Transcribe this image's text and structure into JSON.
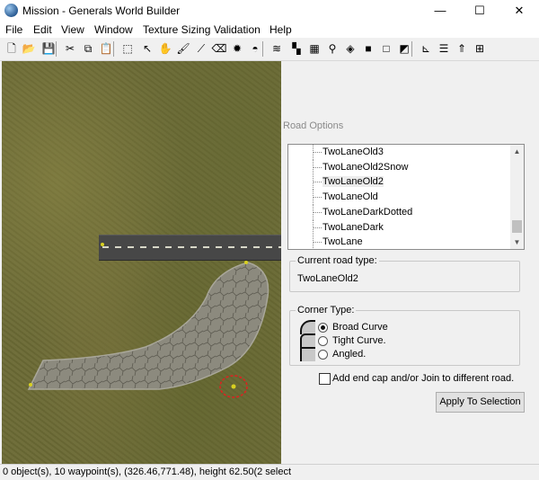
{
  "window": {
    "title": "Mission - Generals World Builder",
    "controls": [
      "—",
      "☐",
      "✕"
    ]
  },
  "menu": [
    "File",
    "Edit",
    "View",
    "Window",
    "Texture Sizing",
    "Validation",
    "Help"
  ],
  "toolbar_icons": [
    {
      "name": "new-file-icon",
      "glyph": "🗋"
    },
    {
      "name": "open-folder-icon",
      "glyph": "📂"
    },
    {
      "name": "save-icon",
      "glyph": "💾"
    },
    {
      "name": "cut-icon",
      "glyph": "✂"
    },
    {
      "name": "copy-icon",
      "glyph": "⧉"
    },
    {
      "name": "paste-icon",
      "glyph": "📋"
    },
    {
      "name": "select-icon",
      "glyph": "⬚"
    },
    {
      "name": "pointer-icon",
      "glyph": "↖"
    },
    {
      "name": "hand-icon",
      "glyph": "✋"
    },
    {
      "name": "brush-icon",
      "glyph": "🖌"
    },
    {
      "name": "feather-brush-icon",
      "glyph": "⟋"
    },
    {
      "name": "eraser-icon",
      "glyph": "⌫"
    },
    {
      "name": "sunburst-icon",
      "glyph": "✹"
    },
    {
      "name": "mound-icon",
      "glyph": "◓"
    },
    {
      "name": "water-icon",
      "glyph": "≋"
    },
    {
      "name": "tile-icon",
      "glyph": "▚"
    },
    {
      "name": "checker-icon",
      "glyph": "▦"
    },
    {
      "name": "eyedropper-icon",
      "glyph": "⚲"
    },
    {
      "name": "fill-icon",
      "glyph": "◈"
    },
    {
      "name": "square-icon",
      "glyph": "■"
    },
    {
      "name": "outline-square-icon",
      "glyph": "□"
    },
    {
      "name": "gradient-icon",
      "glyph": "◩"
    },
    {
      "name": "axis-icon",
      "glyph": "⊾"
    },
    {
      "name": "road-icon",
      "glyph": "☰"
    },
    {
      "name": "tree-icon",
      "glyph": "⇑"
    },
    {
      "name": "grid-icon",
      "glyph": "⊞"
    }
  ],
  "status": {
    "text": "0 object(s), 10 waypoint(s), (326.46,771.48), height 62.50(2 select"
  },
  "road_options": {
    "title": "Road Options",
    "items": [
      "TwoLaneOld3",
      "TwoLaneOld2Snow",
      "TwoLaneOld2",
      "TwoLaneOld",
      "TwoLaneDarkDotted",
      "TwoLaneDark",
      "TwoLane"
    ],
    "selected_index": 2,
    "current_label": "Current road type:",
    "current_value": "TwoLaneOld2",
    "corner_label": "Corner Type:",
    "corners": [
      "Broad Curve",
      "Tight Curve.",
      "Angled."
    ],
    "corner_selected": 0,
    "endcap_label": "Add end cap and/or Join to different road.",
    "endcap_checked": false,
    "apply_label": "Apply To Selection"
  },
  "colors": {
    "terrain": "#6b6a35",
    "road_asphalt": "#474747",
    "path_dirt": "#8a887c",
    "waypoint": "#d8d020",
    "waypoint_ring": "#e02020"
  }
}
